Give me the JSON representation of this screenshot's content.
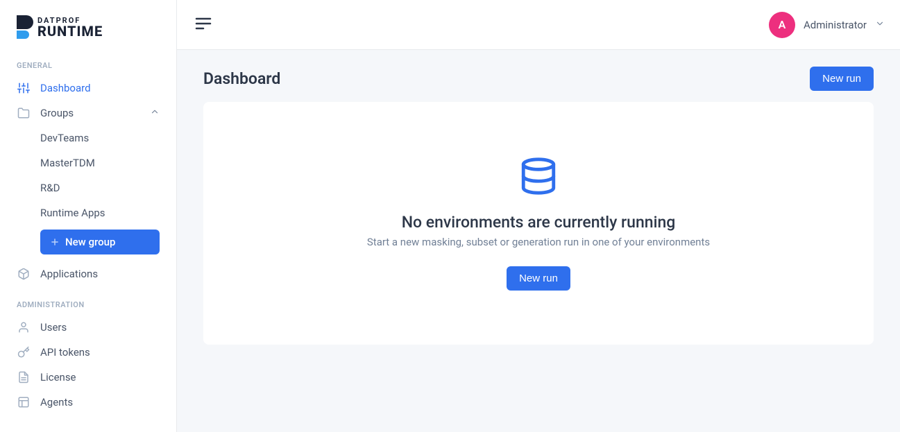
{
  "logo": {
    "top": "DATPROF",
    "bottom": "RUNTIME"
  },
  "sidebar": {
    "sections": {
      "general": {
        "title": "GENERAL",
        "items": {
          "dashboard": "Dashboard",
          "groups": "Groups",
          "applications": "Applications"
        },
        "groupChildren": [
          "DevTeams",
          "MasterTDM",
          "R&D",
          "Runtime Apps"
        ],
        "newGroup": "New group"
      },
      "admin": {
        "title": "ADMINISTRATION",
        "items": {
          "users": "Users",
          "apiTokens": "API tokens",
          "license": "License",
          "agents": "Agents"
        }
      }
    }
  },
  "topbar": {
    "user": {
      "initial": "A",
      "name": "Administrator"
    }
  },
  "page": {
    "title": "Dashboard",
    "newRunButton": "New run",
    "empty": {
      "title": "No environments are currently running",
      "subtitle": "Start a new masking, subset or generation run in one of your environments",
      "button": "New run"
    }
  }
}
